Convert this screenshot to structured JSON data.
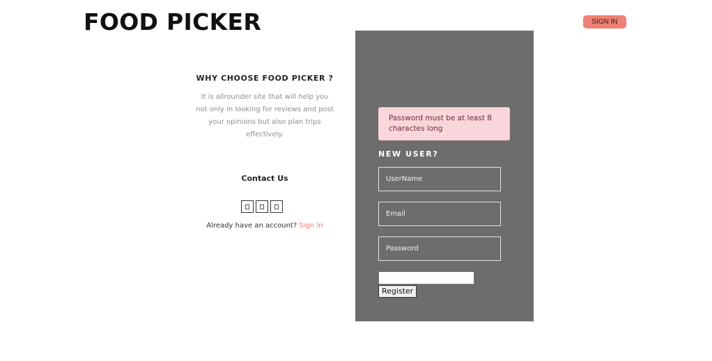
{
  "header": {
    "logo_text": "FOOD PICKER",
    "signin_label": "SIGN IN",
    "signin_color": "#f08074"
  },
  "info": {
    "heading": "WHY CHOOSE FOOD PICKER ?",
    "description": "It is allrounder site that will help you not only in looking for reviews and post your opinions but also plan trips effectively."
  },
  "contact": {
    "title": "Contact Us",
    "social_icons": [
      "social-icon-1",
      "social-icon-2",
      "social-icon-3"
    ],
    "already_text": "Already have an account?",
    "signin_link": "Sign In"
  },
  "form": {
    "panel_color": "#6d6d6d",
    "alert_message": "Password must be at least 8 charactes long",
    "title": "NEW USER?",
    "username_placeholder": "UserName",
    "email_placeholder": "Email",
    "password_placeholder": "Password",
    "register_label": "Register"
  }
}
